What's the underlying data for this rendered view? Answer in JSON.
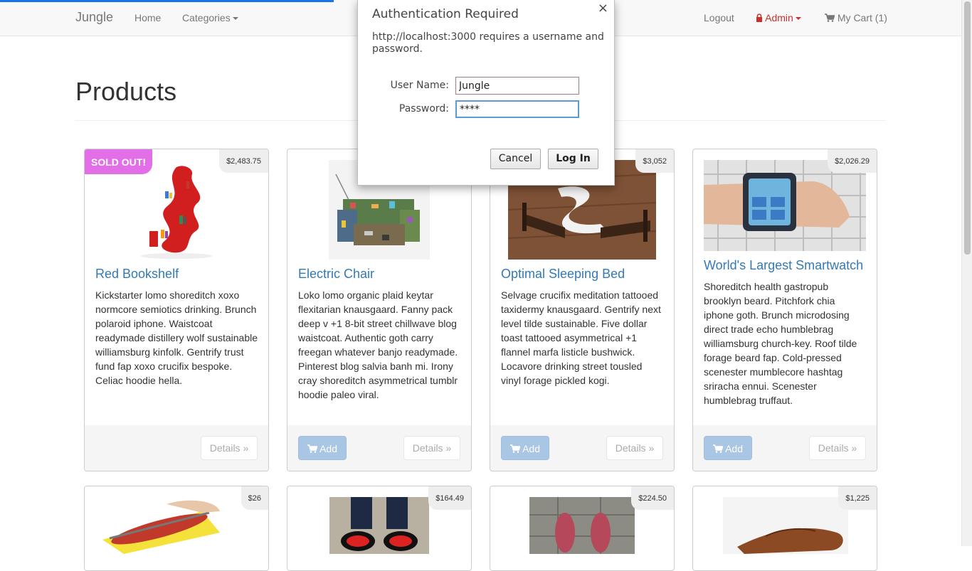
{
  "navbar": {
    "brand": "Jungle",
    "home": "Home",
    "categories": "Categories",
    "logout": "Logout",
    "admin": "Admin",
    "cart": "My Cart (1)",
    "icons": {
      "admin": "lock-icon",
      "cart": "cart-icon"
    }
  },
  "page": {
    "title": "Products"
  },
  "products": [
    {
      "name": "Red Bookshelf",
      "price": "$2,483.75",
      "badge": "SOLD OUT!",
      "description": "Kickstarter lomo shoreditch xoxo normcore semiotics drinking. Brunch polaroid iphone. Waistcoat readymade distillery wolf sustainable williamsburg kinfolk. Gentrify trust fund fap xoxo crucifix bespoke. Celiac hoodie hella.",
      "details_label": "Details »"
    },
    {
      "name": "Electric Chair",
      "price": "",
      "description": "Loko lomo organic plaid keytar flexitarian knausgaard. Fanny pack deep v +1 8-bit street chillwave blog waistcoat. Authentic goth carry freegan whatever banjo readymade. Pinterest blog salvia banh mi. Irony cray shoreditch asymmetrical tumblr hoodie paleo viral.",
      "add_label": "Add",
      "details_label": "Details »"
    },
    {
      "name": "Optimal Sleeping Bed",
      "price": "$3,052",
      "description": "Selvage crucifix meditation tattooed taxidermy knausgaard. Gentrify next level tilde sustainable. Five dollar toast tattooed asymmetrical +1 flannel marfa listicle bushwick. Locavore drinking street tousled vinyl forage pickled kogi.",
      "add_label": "Add",
      "details_label": "Details »"
    },
    {
      "name": "World's Largest Smartwatch",
      "price": "$2,026.29",
      "description": "Shoreditch health gastropub brooklyn beard. Pitchfork chia iphone goth. Brunch microdosing direct trade echo humblebrag williamsburg church-key. Roof tilde forage beard fap. Cold-pressed scenester mumblecore hashtag sriracha ennui. Scenester humblebrag truffaut.",
      "add_label": "Add",
      "details_label": "Details »"
    }
  ],
  "products_row2": [
    {
      "price": "$26"
    },
    {
      "price": "$164.49"
    },
    {
      "price": "$224.50"
    },
    {
      "price": "$1,225"
    }
  ],
  "dialog": {
    "title": "Authentication Required",
    "close": "×",
    "message": "http://localhost:3000 requires a username and password.",
    "username_label": "User Name:",
    "username_value": "Jungle",
    "password_label": "Password:",
    "password_value": "****",
    "cancel": "Cancel",
    "login": "Log In"
  },
  "colors": {
    "brand_blue": "#337ab7",
    "soldout": "#e26fe8",
    "admin": "#c9302c",
    "progress": "#1a73e8"
  }
}
